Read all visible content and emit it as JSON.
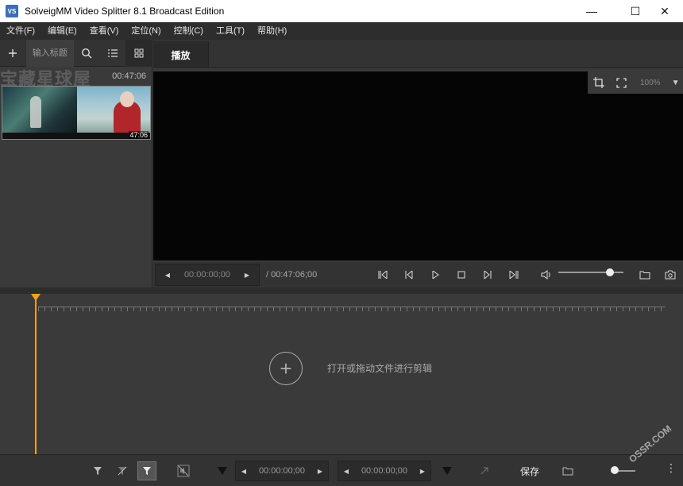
{
  "window": {
    "app_icon": "VS",
    "title": "SolveigMM Video Splitter 8.1 Broadcast Edition",
    "minimize": "—",
    "maximize": "☐",
    "close": "✕"
  },
  "menu": [
    "文件(F)",
    "编辑(E)",
    "查看(V)",
    "定位(N)",
    "控制(C)",
    "工具(T)",
    "帮助(H)"
  ],
  "left_panel": {
    "search_placeholder": "输入标题",
    "watermark": "宝藏星球屋",
    "top_duration": "00:47:06",
    "clip_duration": "47:06"
  },
  "tabs": [
    "播放"
  ],
  "preview": {
    "zoom": "100%"
  },
  "playbar": {
    "current_time": "00:00:00;00",
    "total_time": "/ 00:47:06;00"
  },
  "timeline": {
    "open_hint": "打开或拖动文件进行剪辑",
    "add_symbol": "+"
  },
  "bottombar": {
    "start_time": "00:00:00;00",
    "end_time": "00:00:00;00",
    "save_label": "保存",
    "more": "⋮"
  },
  "corner_watermark": "OSSR.COM",
  "colors": {
    "playhead": "#f0a020",
    "background": "#3a3a3a"
  }
}
